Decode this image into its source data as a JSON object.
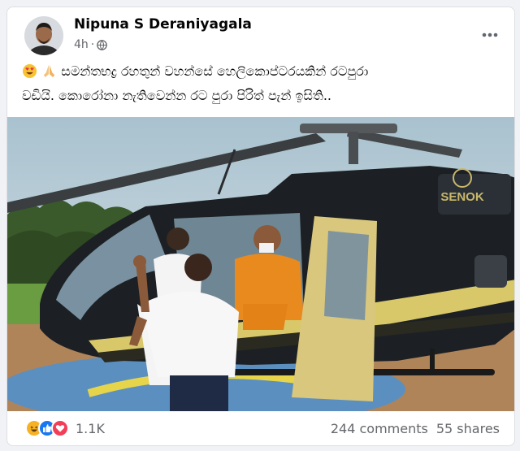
{
  "post": {
    "author_name": "Nipuna S Deraniyagala",
    "time": "4h",
    "privacy_icon": "globe-icon",
    "body_line1": "සමන්තභද්‍ර රහතුන් වහන්සේ හෙලිකොප්ටරයකින් රටපුරා",
    "body_line2": "වඩියි. කොරෝනා නැතිවෙන්න රට පුරා පිරිත් පැන් ඉසිති..",
    "leading_emojis": [
      "heart-eyes-emoji",
      "folded-hands-emoji"
    ],
    "photo_label": "SENOK"
  },
  "footer": {
    "reaction_icons": [
      "haha-reaction-icon",
      "like-reaction-icon",
      "love-reaction-icon"
    ],
    "reaction_count": "1.1K",
    "comments": "244 comments",
    "shares": "55 shares"
  },
  "colors": {
    "like": "#1877f2",
    "love": "#f33e58",
    "haha": "#f7b125",
    "robe": "#e98a1e",
    "helicopter_body": "#1c2024",
    "helicopter_stripe": "#d9c86a"
  }
}
